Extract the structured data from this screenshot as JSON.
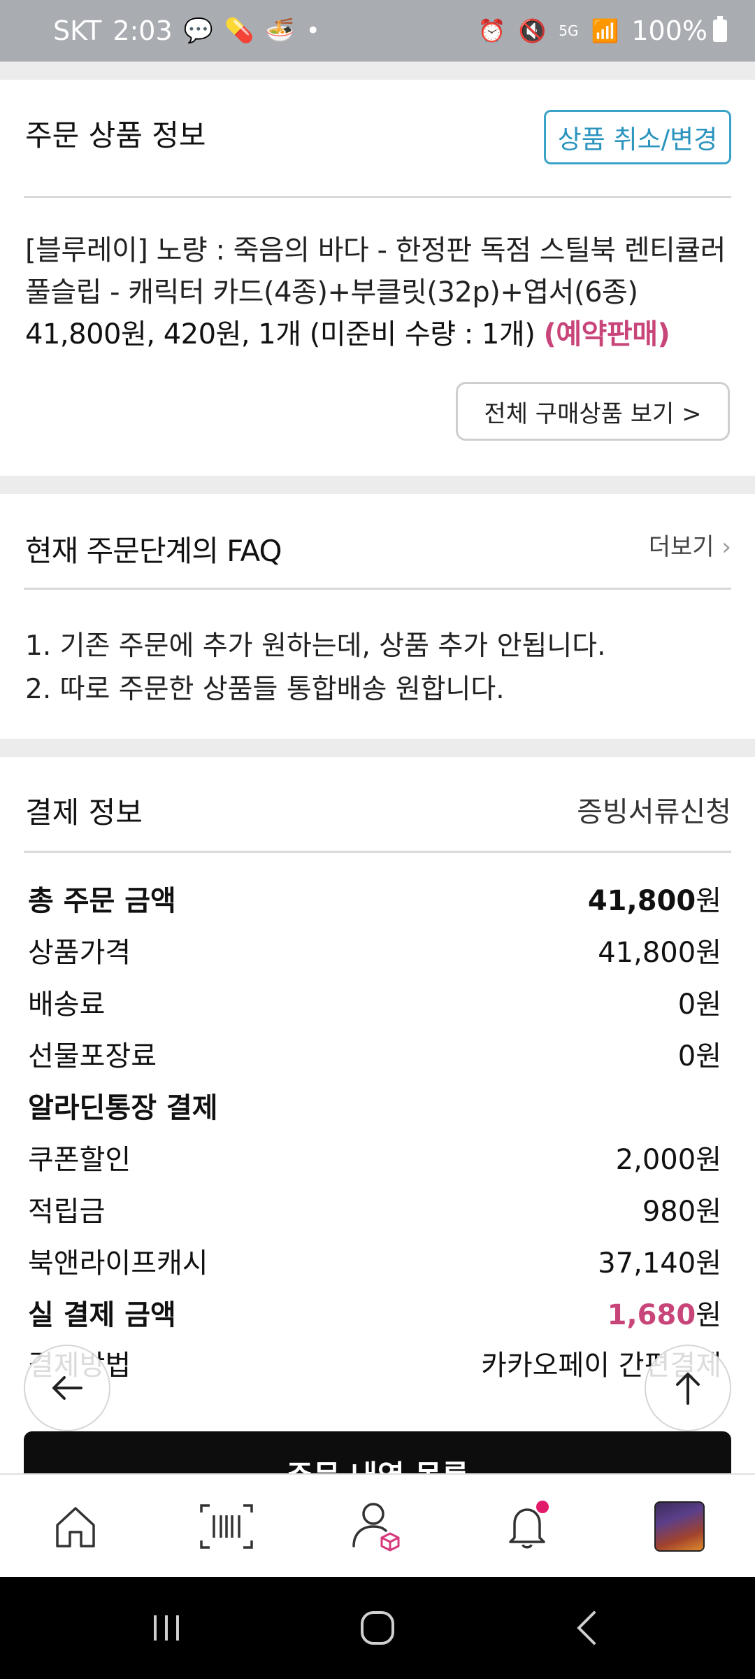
{
  "status_bar": {
    "carrier": "SKT",
    "time": "2:03",
    "network": "5G",
    "battery": "100%"
  },
  "product_section": {
    "title": "주문 상품 정보",
    "cancel_button": "상품 취소/변경",
    "product_name": "[블루레이] 노량 : 죽음의 바다 - 한정판 독점 스틸북 렌티큘러 풀슬립 - 캐릭터 카드(4종)+부클릿(32p)+엽서(6종)",
    "product_detail": "41,800원, 420원, 1개 (미준비 수량 : 1개)",
    "preorder_tag": "(예약판매)",
    "view_all_button": "전체 구매상품 보기 >"
  },
  "faq_section": {
    "title": "현재 주문단계의 FAQ",
    "more_label": "더보기",
    "items": [
      "1. 기존 주문에 추가 원하는데, 상품 추가 안됩니다.",
      "2. 따로 주문한 상품들 통합배송 원합니다."
    ]
  },
  "payment_section": {
    "title": "결제 정보",
    "receipt_link": "증빙서류신청",
    "rows": [
      {
        "label": "총 주문 금액",
        "amount": "41,800",
        "unit": "원"
      },
      {
        "label": "상품가격",
        "amount": "41,800",
        "unit": "원"
      },
      {
        "label": "배송료",
        "amount": "0",
        "unit": "원"
      },
      {
        "label": "선물포장료",
        "amount": "0",
        "unit": "원"
      },
      {
        "label": "알라딘통장 결제",
        "amount": "",
        "unit": ""
      },
      {
        "label": "쿠폰할인",
        "amount": "2,000",
        "unit": "원"
      },
      {
        "label": "적립금",
        "amount": "980",
        "unit": "원"
      },
      {
        "label": "북앤라이프캐시",
        "amount": "37,140",
        "unit": "원"
      },
      {
        "label": "실 결제 금액",
        "amount": "1,680",
        "unit": "원"
      },
      {
        "label": "결제방법",
        "amount": "카카오페이 간편결제",
        "unit": ""
      }
    ]
  },
  "order_list_button": "주문 내역 목록",
  "colors": {
    "accent_pink": "#c8457a",
    "accent_blue": "#2a94be",
    "status_bar": "#a9acb0"
  },
  "icons": {
    "nav": [
      "home-icon",
      "barcode-icon",
      "my-account-icon",
      "bell-icon",
      "profile-thumbnail"
    ],
    "fab": [
      "back-arrow-icon",
      "scroll-top-icon"
    ]
  }
}
